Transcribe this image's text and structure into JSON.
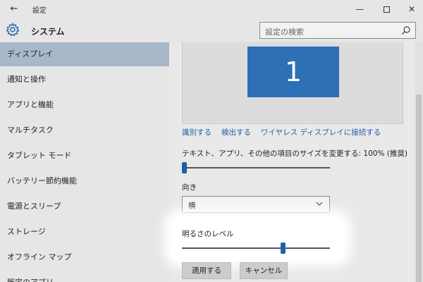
{
  "window": {
    "title": "設定",
    "back_glyph": "←",
    "min_glyph": "—",
    "close_glyph": "✕"
  },
  "header": {
    "section_title": "システム",
    "search_placeholder": "設定の検索"
  },
  "sidebar": {
    "items": [
      {
        "label": "ディスプレイ",
        "selected": true
      },
      {
        "label": "通知と操作"
      },
      {
        "label": "アプリと機能"
      },
      {
        "label": "マルチタスク"
      },
      {
        "label": "タブレット モード"
      },
      {
        "label": "バッテリー節約機能"
      },
      {
        "label": "電源とスリープ"
      },
      {
        "label": "ストレージ"
      },
      {
        "label": "オフライン マップ"
      },
      {
        "label": "既定のアプリ"
      }
    ]
  },
  "display": {
    "monitor_number": "1",
    "links": {
      "identify": "識別する",
      "detect": "検出する",
      "wireless": "ワイヤレス ディスプレイに接続する"
    },
    "scale_label": "テキスト、アプリ、その他の項目のサイズを変更する: 100% (推奨)",
    "scale_slider_fraction": 0.0,
    "orientation_label": "向き",
    "orientation_value": "横",
    "brightness_label": "明るさのレベル",
    "brightness_fraction": 0.69,
    "apply_button": "適用する",
    "cancel_button": "キャンセル"
  },
  "colors": {
    "accent": "#1f5fa8",
    "monitor": "#2d70b6",
    "selected_nav": "#a9b8c8"
  }
}
